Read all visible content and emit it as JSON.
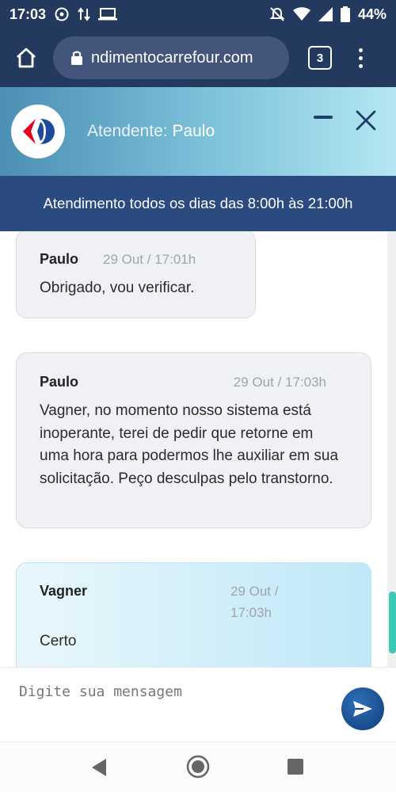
{
  "status_bar": {
    "time": "17:03",
    "battery": "44%"
  },
  "browser": {
    "url": "ndimentocarrefour.com",
    "tab_count": "3"
  },
  "chat_header": {
    "title_prefix": "Atendente:",
    "agent_name": "Paulo"
  },
  "hours_banner": "Atendimento todos os dias das 8:00h às 21:00h",
  "messages": [
    {
      "author": "Paulo",
      "time": "29 Out / 17:01h",
      "text": "Obrigado, vou verificar.",
      "sender": "agent"
    },
    {
      "author": "Paulo",
      "time": "29 Out / 17:03h",
      "text": "Vagner, no momento nosso sistema está inoperante, terei de pedir que retorne em uma hora para podermos lhe auxiliar em sua solicitação. Peço desculpas pelo transtorno.",
      "sender": "agent"
    },
    {
      "author": "Vagner",
      "time_line1": "29 Out /",
      "time_line2": "17:03h",
      "text": "Certo",
      "sender": "user"
    }
  ],
  "composer": {
    "placeholder": "Digite sua mensagem"
  },
  "colors": {
    "status_bar": "#23395d",
    "banner": "#2b4a80",
    "send_button": "#0d3e7a",
    "carrefour_red": "#e2001a",
    "carrefour_blue": "#1e4a9c"
  }
}
